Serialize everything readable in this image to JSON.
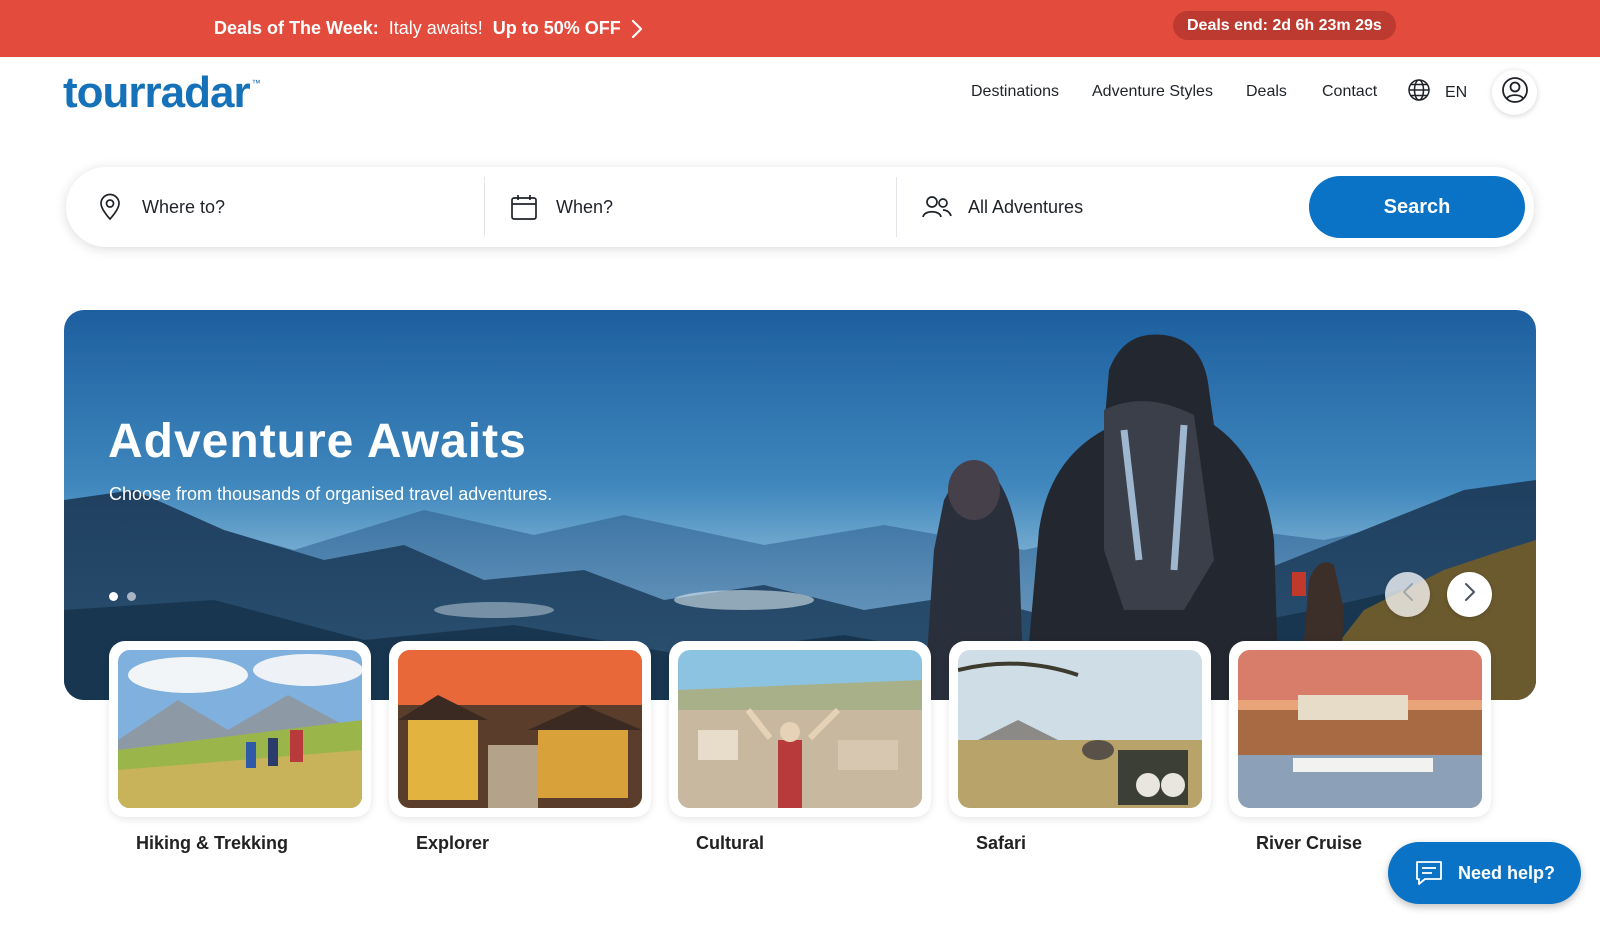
{
  "promo": {
    "deals_label": "Deals of The Week:",
    "message": "Italy awaits!",
    "offer": "Up to 50% OFF",
    "countdown": "Deals end: 2d 6h 23m 29s",
    "background": "#e34b3c"
  },
  "header": {
    "logo_text": "tourradar",
    "logo_tm": "™",
    "nav": [
      {
        "label": "Destinations"
      },
      {
        "label": "Adventure Styles"
      },
      {
        "label": "Deals"
      },
      {
        "label": "Contact"
      }
    ],
    "language": "EN",
    "brand_color": "#1672b8"
  },
  "search": {
    "where_placeholder": "Where to?",
    "when_placeholder": "When?",
    "adventure_value": "All Adventures",
    "button_label": "Search",
    "button_color": "#0b73c6"
  },
  "hero": {
    "title": "Adventure Awaits",
    "subtitle": "Choose from thousands of organised travel adventures.",
    "slide_count": 2,
    "active_slide": 1
  },
  "categories": [
    {
      "label": "Hiking & Trekking"
    },
    {
      "label": "Explorer"
    },
    {
      "label": "Cultural"
    },
    {
      "label": "Safari"
    },
    {
      "label": "River Cruise"
    }
  ],
  "help": {
    "label": "Need help?"
  },
  "icons": [
    "chevron-right-icon",
    "globe-icon",
    "user-icon",
    "location-pin-icon",
    "calendar-icon",
    "people-icon",
    "chevron-left-icon",
    "chat-icon"
  ]
}
